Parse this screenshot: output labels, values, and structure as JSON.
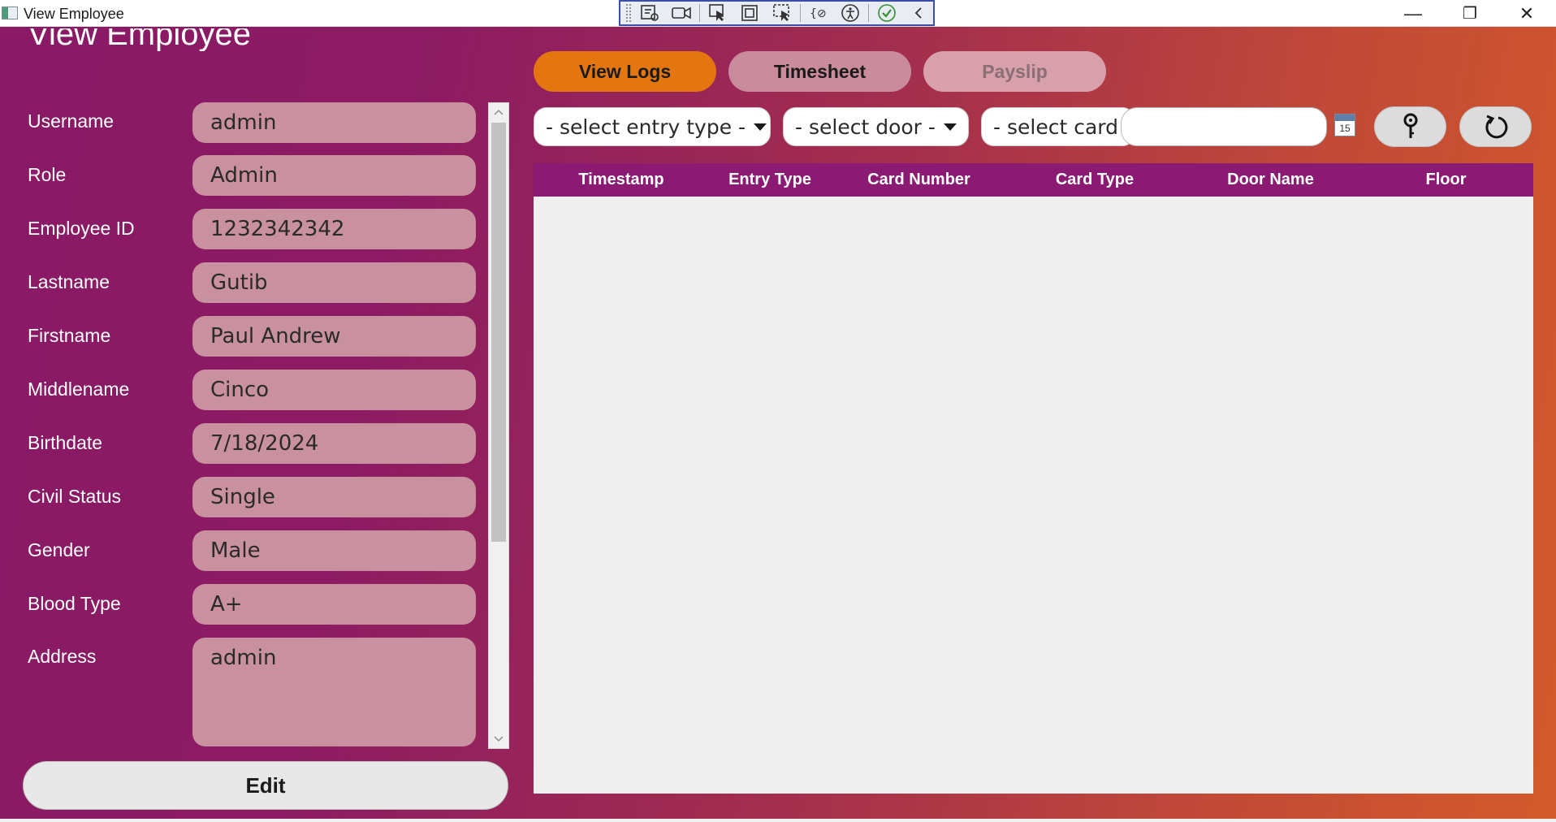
{
  "window": {
    "title": "View Employee",
    "controls": {
      "minimize": "—",
      "restore": "❐",
      "close": "✕"
    }
  },
  "page": {
    "title": "View Employee"
  },
  "form": {
    "fields": [
      {
        "label": "Username",
        "value": "admin"
      },
      {
        "label": "Role",
        "value": "Admin"
      },
      {
        "label": "Employee ID",
        "value": "1232342342"
      },
      {
        "label": "Lastname",
        "value": "Gutib"
      },
      {
        "label": "Firstname",
        "value": "Paul Andrew"
      },
      {
        "label": "Middlename",
        "value": "Cinco"
      },
      {
        "label": "Birthdate",
        "value": "7/18/2024"
      },
      {
        "label": "Civil Status",
        "value": "Single"
      },
      {
        "label": "Gender",
        "value": "Male"
      },
      {
        "label": "Blood Type",
        "value": "A+"
      },
      {
        "label": "Address",
        "value": "admin"
      }
    ],
    "edit_label": "Edit"
  },
  "tabs": [
    {
      "label": "View Logs",
      "state": "active"
    },
    {
      "label": "Timesheet",
      "state": "normal"
    },
    {
      "label": "Payslip",
      "state": "disabled"
    }
  ],
  "filters": {
    "entry_type": "- select entry type -",
    "door": "- select door -",
    "card": "- select card -",
    "date_value": "",
    "calendar_day": "15"
  },
  "table": {
    "columns": [
      "Timestamp",
      "Entry Type",
      "Card Number",
      "Card Type",
      "Door Name",
      "Floor"
    ],
    "rows": []
  },
  "colors": {
    "accent": "#e37610",
    "header": "#8b1a72",
    "field_bg": "#c9909f"
  }
}
